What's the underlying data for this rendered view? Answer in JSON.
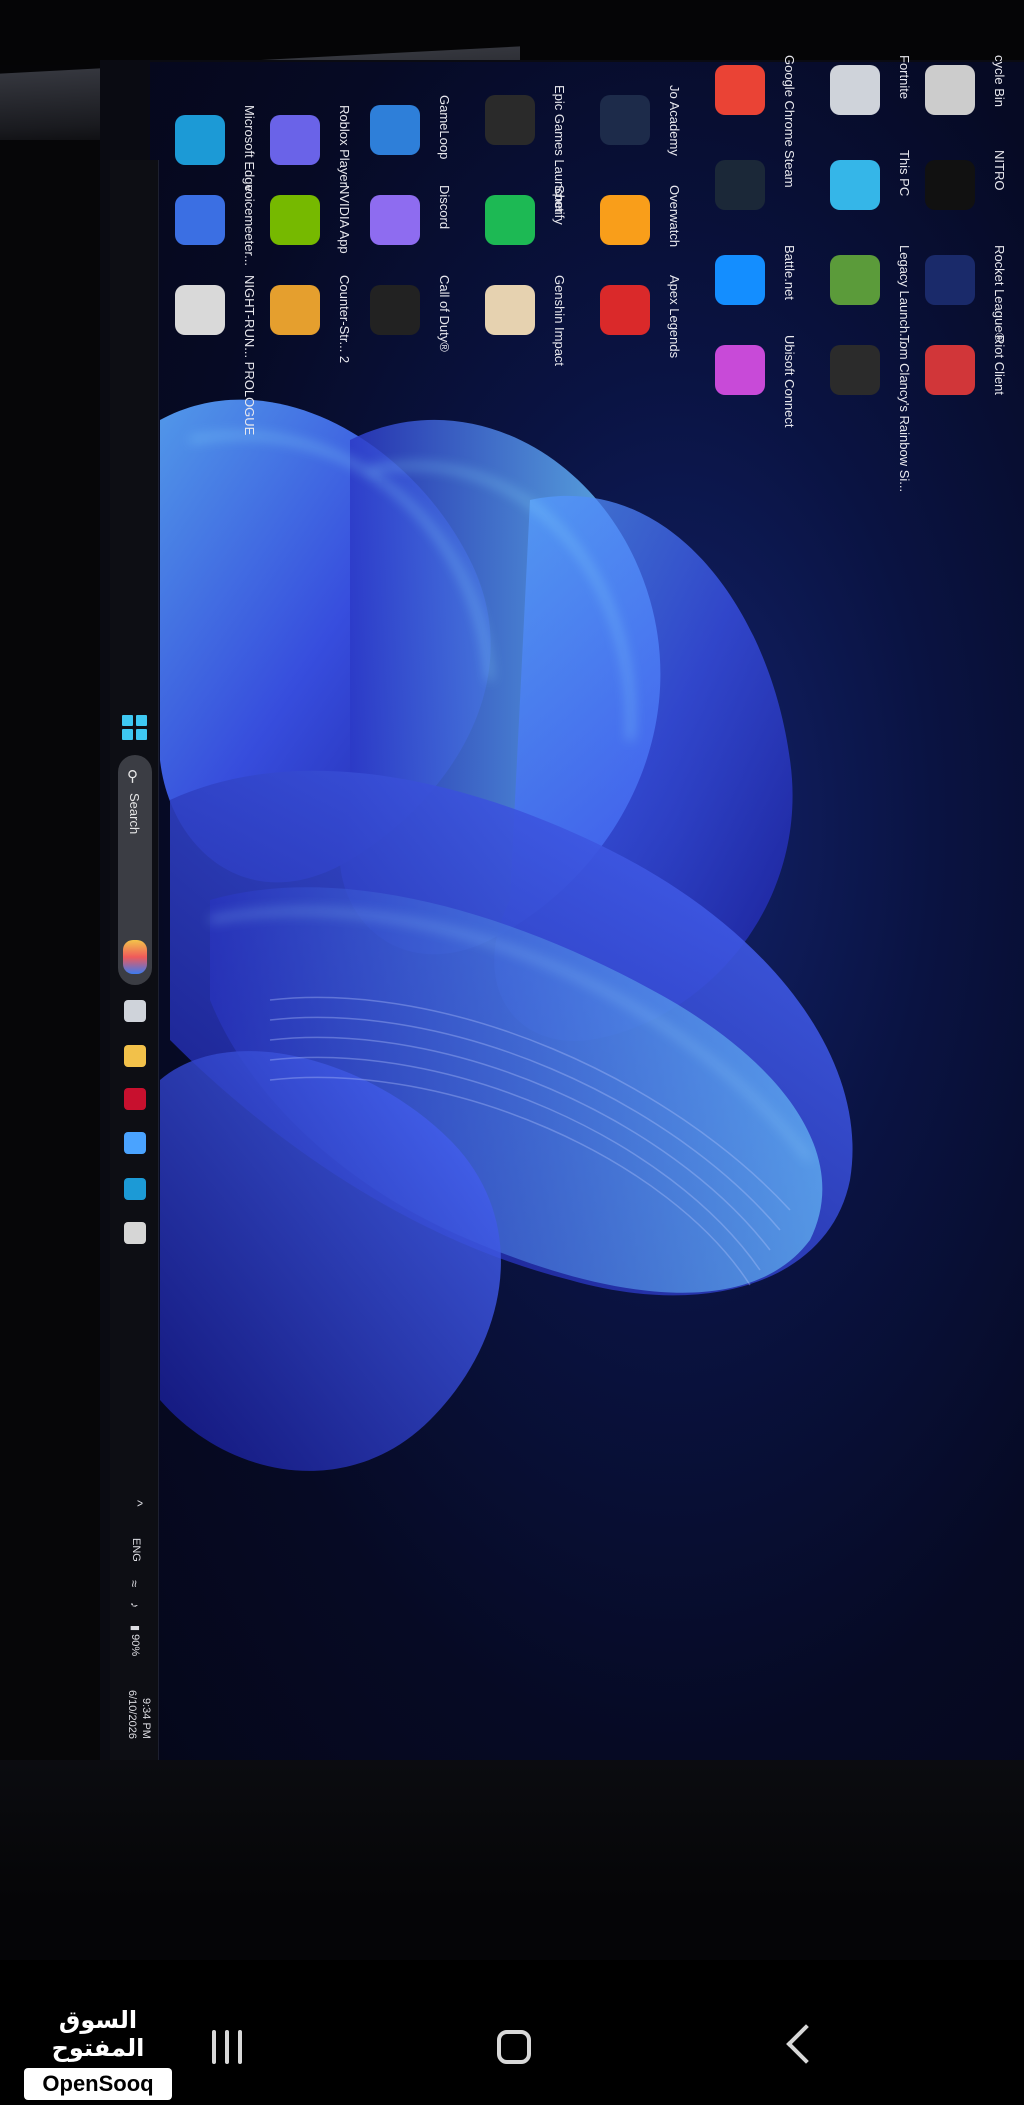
{
  "desktop_icons": [
    {
      "id": "recycle-bin",
      "label": "cycle Bin",
      "color": "#cccccc"
    },
    {
      "id": "nitro",
      "label": "NITRO",
      "color": "#111111"
    },
    {
      "id": "rocket-league",
      "label": "Rocket League®",
      "color": "#1a2a6a"
    },
    {
      "id": "riot-client",
      "label": "Riot Client",
      "color": "#d13639"
    },
    {
      "id": "fortnite",
      "label": "Fortnite",
      "color": "#cfd3da"
    },
    {
      "id": "this-pc",
      "label": "This PC",
      "color": "#35b6e8"
    },
    {
      "id": "legacy-launcher",
      "label": "Legacy Launch...",
      "color": "#5b9b3a"
    },
    {
      "id": "rainbow-six",
      "label": "Tom Clancy's Rainbow Si...",
      "color": "#2b2b2b"
    },
    {
      "id": "google-chrome",
      "label": "Google Chrome",
      "color": "#ea4335"
    },
    {
      "id": "steam",
      "label": "Steam",
      "color": "#1b2838"
    },
    {
      "id": "battle-net",
      "label": "Battle.net",
      "color": "#148eff"
    },
    {
      "id": "ubisoft-connect",
      "label": "Ubisoft Connect",
      "color": "#c84ad8"
    },
    {
      "id": "jo-academy",
      "label": "Jo Academy",
      "color": "#1d2b4a"
    },
    {
      "id": "overwatch",
      "label": "Overwatch",
      "color": "#f99e1a"
    },
    {
      "id": "apex-legends",
      "label": "Apex Legends",
      "color": "#da292a"
    },
    {
      "id": "epic-games",
      "label": "Epic Games Launcher",
      "color": "#2a2a2a"
    },
    {
      "id": "spotify",
      "label": "Spotify",
      "color": "#1db954"
    },
    {
      "id": "genshin-impact",
      "label": "Genshin Impact",
      "color": "#e6d2b0"
    },
    {
      "id": "gameloop",
      "label": "GameLoop",
      "color": "#2e7fd9"
    },
    {
      "id": "discord",
      "label": "Discord",
      "color": "#8e6cf0"
    },
    {
      "id": "call-of-duty",
      "label": "Call of Duty®",
      "color": "#222222"
    },
    {
      "id": "roblox-player",
      "label": "Roblox Player",
      "color": "#6a63e8"
    },
    {
      "id": "nvidia-app",
      "label": "NVIDIA App",
      "color": "#76b900"
    },
    {
      "id": "counter-strike",
      "label": "Counter-Str... 2",
      "color": "#e59f2e"
    },
    {
      "id": "microsoft-edge",
      "label": "Microsoft Edge",
      "color": "#1c9ad6"
    },
    {
      "id": "voicemeeter",
      "label": "voicemeeter...",
      "color": "#3b6fe3"
    },
    {
      "id": "night-run",
      "label": "NIGHT-RUN... PROLOGUE",
      "color": "#d9d9d9"
    }
  ],
  "taskbar": {
    "search_label": "Search",
    "apps": [
      {
        "id": "task-view",
        "color": "#cfd3da"
      },
      {
        "id": "file-explorer",
        "color": "#f2c14a"
      },
      {
        "id": "mcafee",
        "color": "#c8102e"
      },
      {
        "id": "copilot",
        "color": "#4aa3ff"
      },
      {
        "id": "edge",
        "color": "#1c9ad6"
      },
      {
        "id": "store",
        "color": "#d6d6d6"
      }
    ],
    "tray": {
      "chevron": "^",
      "language": "ENG",
      "battery": "90%",
      "time": "9:34 PM",
      "date": "6/10/2026"
    }
  },
  "watermark": {
    "arabic": "السوق المفتوح",
    "english": "OpenSooq"
  },
  "colors": {
    "wallpaper_accent": "#2d5cff",
    "taskbar_bg": "#0d0e14",
    "start_blue": "#3ec8f2"
  }
}
